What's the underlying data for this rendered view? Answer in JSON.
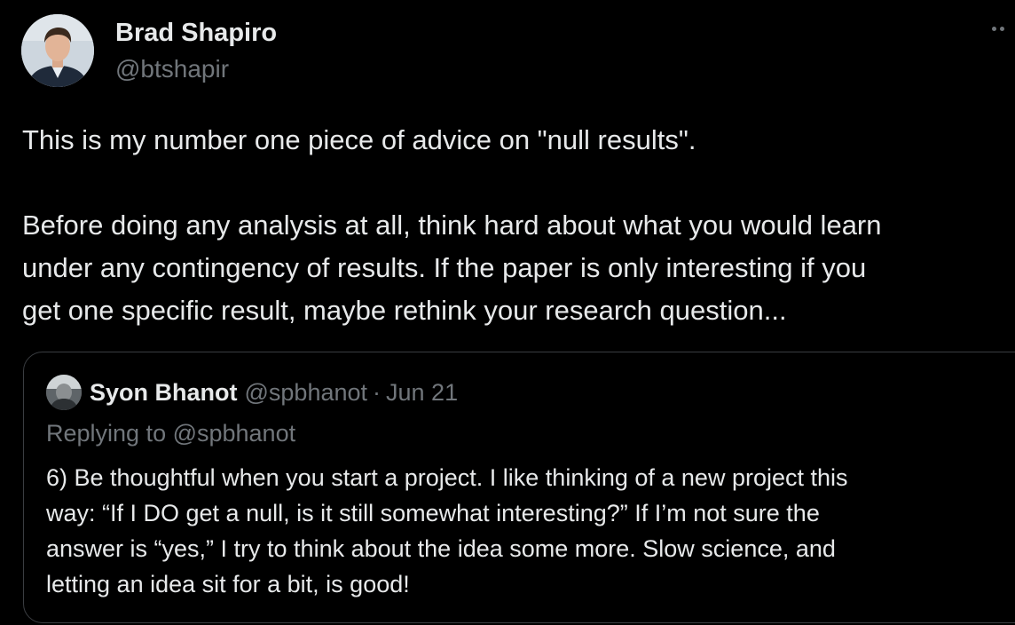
{
  "tweet": {
    "author": {
      "name": "Brad Shapiro",
      "handle": "@btshapir"
    },
    "text_lines": [
      "This is my number one piece of advice on \"null results\".",
      "Before doing any analysis at all, think hard about what you would learn",
      "under any contingency of results. If the paper is only interesting if you",
      "get one specific result, maybe rethink your research question..."
    ],
    "more_icon": "more-horizontal-icon"
  },
  "quote": {
    "author": {
      "name": "Syon Bhanot",
      "handle": "@spbhanot",
      "separator": "·",
      "date": "Jun 21"
    },
    "reply_context": "Replying to @spbhanot",
    "text_lines": [
      "6) Be thoughtful when you start a project. I like thinking of a new project this",
      "way: “If I DO get a null, is it still somewhat interesting?” If I’m not sure the",
      "answer is “yes,” I try to think about the idea some more. Slow science, and",
      "letting an idea sit for a bit, is good!"
    ]
  },
  "colors": {
    "background": "#000000",
    "primary_text": "#e7e9ea",
    "secondary_text": "#71767b",
    "border": "#3a3d41"
  }
}
